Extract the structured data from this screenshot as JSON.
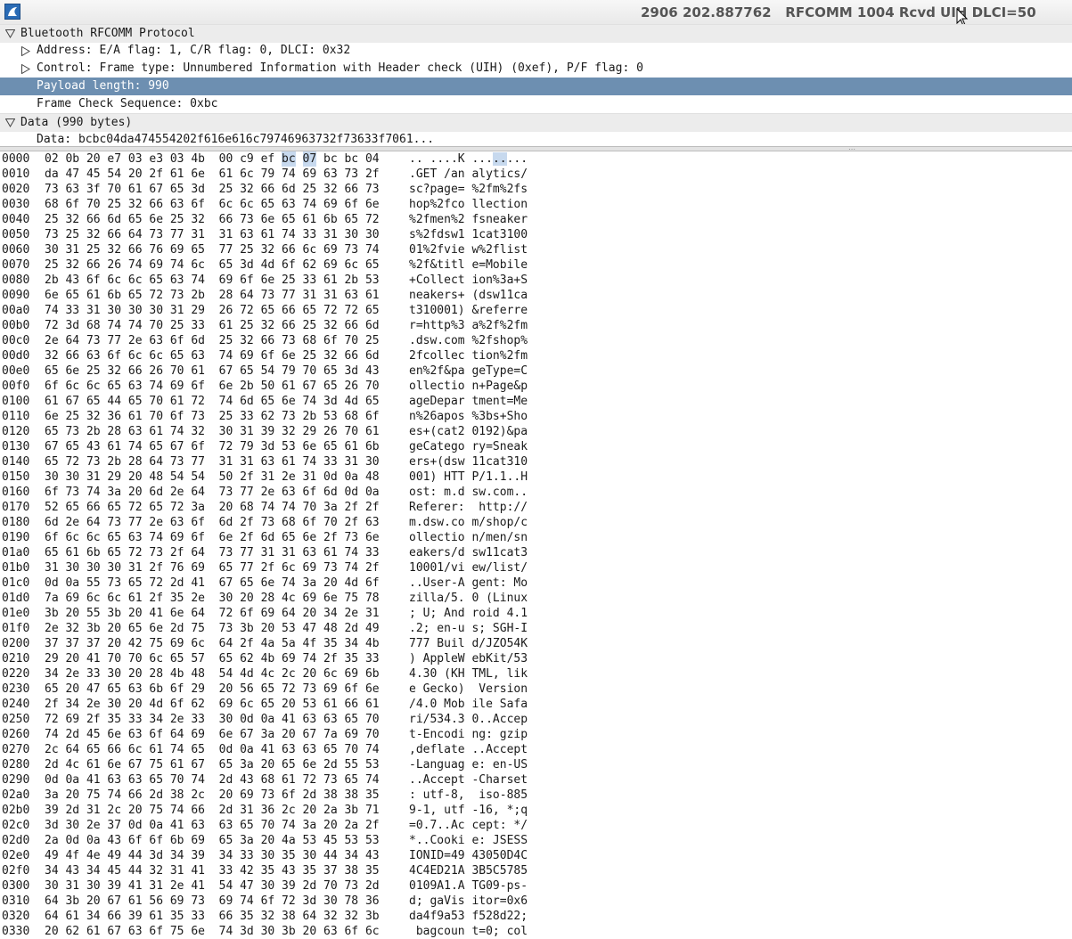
{
  "window": {
    "title": "2906 202.887762   RFCOMM 1004 Rcvd UIH DLCI=50",
    "icon": "wireshark-fin-icon"
  },
  "tree": [
    {
      "label": "Bluetooth RFCOMM Protocol",
      "level": 0,
      "expander": "expanded",
      "header": true
    },
    {
      "label": "Address: E/A flag: 1, C/R flag: 0, DLCI: 0x32",
      "level": 1,
      "expander": "collapsed"
    },
    {
      "label": "Control: Frame type: Unnumbered Information with Header check (UIH) (0xef), P/F flag: 0",
      "level": 1,
      "expander": "collapsed"
    },
    {
      "label": "Payload length: 990",
      "level": 1,
      "expander": "none",
      "selected": true
    },
    {
      "label": "Frame Check Sequence: 0xbc",
      "level": 1,
      "expander": "none"
    },
    {
      "label": "Data (990 bytes)",
      "level": 0,
      "expander": "expanded",
      "header": true
    },
    {
      "label": "Data: bcbc04da474554202f616e616c79746963732f73633f7061...",
      "level": 1,
      "expander": "none"
    }
  ],
  "hex_rows": [
    {
      "offset": "0000",
      "bytes": [
        "02",
        "0b",
        "20",
        "e7",
        "03",
        "e3",
        "03",
        "4b",
        "00",
        "c9",
        "ef",
        "bc",
        "07",
        "bc",
        "bc",
        "04"
      ],
      "ascii": ".. ....K ........"
    },
    {
      "offset": "0010",
      "bytes": [
        "da",
        "47",
        "45",
        "54",
        "20",
        "2f",
        "61",
        "6e",
        "61",
        "6c",
        "79",
        "74",
        "69",
        "63",
        "73",
        "2f"
      ],
      "ascii": ".GET /an alytics/"
    },
    {
      "offset": "0020",
      "bytes": [
        "73",
        "63",
        "3f",
        "70",
        "61",
        "67",
        "65",
        "3d",
        "25",
        "32",
        "66",
        "6d",
        "25",
        "32",
        "66",
        "73"
      ],
      "ascii": "sc?page= %2fm%2fs"
    },
    {
      "offset": "0030",
      "bytes": [
        "68",
        "6f",
        "70",
        "25",
        "32",
        "66",
        "63",
        "6f",
        "6c",
        "6c",
        "65",
        "63",
        "74",
        "69",
        "6f",
        "6e"
      ],
      "ascii": "hop%2fco llection"
    },
    {
      "offset": "0040",
      "bytes": [
        "25",
        "32",
        "66",
        "6d",
        "65",
        "6e",
        "25",
        "32",
        "66",
        "73",
        "6e",
        "65",
        "61",
        "6b",
        "65",
        "72"
      ],
      "ascii": "%2fmen%2 fsneaker"
    },
    {
      "offset": "0050",
      "bytes": [
        "73",
        "25",
        "32",
        "66",
        "64",
        "73",
        "77",
        "31",
        "31",
        "63",
        "61",
        "74",
        "33",
        "31",
        "30",
        "30"
      ],
      "ascii": "s%2fdsw1 1cat3100"
    },
    {
      "offset": "0060",
      "bytes": [
        "30",
        "31",
        "25",
        "32",
        "66",
        "76",
        "69",
        "65",
        "77",
        "25",
        "32",
        "66",
        "6c",
        "69",
        "73",
        "74"
      ],
      "ascii": "01%2fvie w%2flist"
    },
    {
      "offset": "0070",
      "bytes": [
        "25",
        "32",
        "66",
        "26",
        "74",
        "69",
        "74",
        "6c",
        "65",
        "3d",
        "4d",
        "6f",
        "62",
        "69",
        "6c",
        "65"
      ],
      "ascii": "%2f&titl e=Mobile"
    },
    {
      "offset": "0080",
      "bytes": [
        "2b",
        "43",
        "6f",
        "6c",
        "6c",
        "65",
        "63",
        "74",
        "69",
        "6f",
        "6e",
        "25",
        "33",
        "61",
        "2b",
        "53"
      ],
      "ascii": "+Collect ion%3a+S"
    },
    {
      "offset": "0090",
      "bytes": [
        "6e",
        "65",
        "61",
        "6b",
        "65",
        "72",
        "73",
        "2b",
        "28",
        "64",
        "73",
        "77",
        "31",
        "31",
        "63",
        "61"
      ],
      "ascii": "neakers+ (dsw11ca"
    },
    {
      "offset": "00a0",
      "bytes": [
        "74",
        "33",
        "31",
        "30",
        "30",
        "30",
        "31",
        "29",
        "26",
        "72",
        "65",
        "66",
        "65",
        "72",
        "72",
        "65"
      ],
      "ascii": "t310001) &referre"
    },
    {
      "offset": "00b0",
      "bytes": [
        "72",
        "3d",
        "68",
        "74",
        "74",
        "70",
        "25",
        "33",
        "61",
        "25",
        "32",
        "66",
        "25",
        "32",
        "66",
        "6d"
      ],
      "ascii": "r=http%3 a%2f%2fm"
    },
    {
      "offset": "00c0",
      "bytes": [
        "2e",
        "64",
        "73",
        "77",
        "2e",
        "63",
        "6f",
        "6d",
        "25",
        "32",
        "66",
        "73",
        "68",
        "6f",
        "70",
        "25"
      ],
      "ascii": ".dsw.com %2fshop%"
    },
    {
      "offset": "00d0",
      "bytes": [
        "32",
        "66",
        "63",
        "6f",
        "6c",
        "6c",
        "65",
        "63",
        "74",
        "69",
        "6f",
        "6e",
        "25",
        "32",
        "66",
        "6d"
      ],
      "ascii": "2fcollec tion%2fm"
    },
    {
      "offset": "00e0",
      "bytes": [
        "65",
        "6e",
        "25",
        "32",
        "66",
        "26",
        "70",
        "61",
        "67",
        "65",
        "54",
        "79",
        "70",
        "65",
        "3d",
        "43"
      ],
      "ascii": "en%2f&pa geType=C"
    },
    {
      "offset": "00f0",
      "bytes": [
        "6f",
        "6c",
        "6c",
        "65",
        "63",
        "74",
        "69",
        "6f",
        "6e",
        "2b",
        "50",
        "61",
        "67",
        "65",
        "26",
        "70"
      ],
      "ascii": "ollectio n+Page&p"
    },
    {
      "offset": "0100",
      "bytes": [
        "61",
        "67",
        "65",
        "44",
        "65",
        "70",
        "61",
        "72",
        "74",
        "6d",
        "65",
        "6e",
        "74",
        "3d",
        "4d",
        "65"
      ],
      "ascii": "ageDepar tment=Me"
    },
    {
      "offset": "0110",
      "bytes": [
        "6e",
        "25",
        "32",
        "36",
        "61",
        "70",
        "6f",
        "73",
        "25",
        "33",
        "62",
        "73",
        "2b",
        "53",
        "68",
        "6f"
      ],
      "ascii": "n%26apos %3bs+Sho"
    },
    {
      "offset": "0120",
      "bytes": [
        "65",
        "73",
        "2b",
        "28",
        "63",
        "61",
        "74",
        "32",
        "30",
        "31",
        "39",
        "32",
        "29",
        "26",
        "70",
        "61"
      ],
      "ascii": "es+(cat2 0192)&pa"
    },
    {
      "offset": "0130",
      "bytes": [
        "67",
        "65",
        "43",
        "61",
        "74",
        "65",
        "67",
        "6f",
        "72",
        "79",
        "3d",
        "53",
        "6e",
        "65",
        "61",
        "6b"
      ],
      "ascii": "geCatego ry=Sneak"
    },
    {
      "offset": "0140",
      "bytes": [
        "65",
        "72",
        "73",
        "2b",
        "28",
        "64",
        "73",
        "77",
        "31",
        "31",
        "63",
        "61",
        "74",
        "33",
        "31",
        "30"
      ],
      "ascii": "ers+(dsw 11cat310"
    },
    {
      "offset": "0150",
      "bytes": [
        "30",
        "30",
        "31",
        "29",
        "20",
        "48",
        "54",
        "54",
        "50",
        "2f",
        "31",
        "2e",
        "31",
        "0d",
        "0a",
        "48"
      ],
      "ascii": "001) HTT P/1.1..H"
    },
    {
      "offset": "0160",
      "bytes": [
        "6f",
        "73",
        "74",
        "3a",
        "20",
        "6d",
        "2e",
        "64",
        "73",
        "77",
        "2e",
        "63",
        "6f",
        "6d",
        "0d",
        "0a"
      ],
      "ascii": "ost: m.d sw.com.."
    },
    {
      "offset": "0170",
      "bytes": [
        "52",
        "65",
        "66",
        "65",
        "72",
        "65",
        "72",
        "3a",
        "20",
        "68",
        "74",
        "74",
        "70",
        "3a",
        "2f",
        "2f"
      ],
      "ascii": "Referer:  http://"
    },
    {
      "offset": "0180",
      "bytes": [
        "6d",
        "2e",
        "64",
        "73",
        "77",
        "2e",
        "63",
        "6f",
        "6d",
        "2f",
        "73",
        "68",
        "6f",
        "70",
        "2f",
        "63"
      ],
      "ascii": "m.dsw.co m/shop/c"
    },
    {
      "offset": "0190",
      "bytes": [
        "6f",
        "6c",
        "6c",
        "65",
        "63",
        "74",
        "69",
        "6f",
        "6e",
        "2f",
        "6d",
        "65",
        "6e",
        "2f",
        "73",
        "6e"
      ],
      "ascii": "ollectio n/men/sn"
    },
    {
      "offset": "01a0",
      "bytes": [
        "65",
        "61",
        "6b",
        "65",
        "72",
        "73",
        "2f",
        "64",
        "73",
        "77",
        "31",
        "31",
        "63",
        "61",
        "74",
        "33"
      ],
      "ascii": "eakers/d sw11cat3"
    },
    {
      "offset": "01b0",
      "bytes": [
        "31",
        "30",
        "30",
        "30",
        "31",
        "2f",
        "76",
        "69",
        "65",
        "77",
        "2f",
        "6c",
        "69",
        "73",
        "74",
        "2f"
      ],
      "ascii": "10001/vi ew/list/"
    },
    {
      "offset": "01c0",
      "bytes": [
        "0d",
        "0a",
        "55",
        "73",
        "65",
        "72",
        "2d",
        "41",
        "67",
        "65",
        "6e",
        "74",
        "3a",
        "20",
        "4d",
        "6f"
      ],
      "ascii": "..User-A gent: Mo"
    },
    {
      "offset": "01d0",
      "bytes": [
        "7a",
        "69",
        "6c",
        "6c",
        "61",
        "2f",
        "35",
        "2e",
        "30",
        "20",
        "28",
        "4c",
        "69",
        "6e",
        "75",
        "78"
      ],
      "ascii": "zilla/5. 0 (Linux"
    },
    {
      "offset": "01e0",
      "bytes": [
        "3b",
        "20",
        "55",
        "3b",
        "20",
        "41",
        "6e",
        "64",
        "72",
        "6f",
        "69",
        "64",
        "20",
        "34",
        "2e",
        "31"
      ],
      "ascii": "; U; And roid 4.1"
    },
    {
      "offset": "01f0",
      "bytes": [
        "2e",
        "32",
        "3b",
        "20",
        "65",
        "6e",
        "2d",
        "75",
        "73",
        "3b",
        "20",
        "53",
        "47",
        "48",
        "2d",
        "49"
      ],
      "ascii": ".2; en-u s; SGH-I"
    },
    {
      "offset": "0200",
      "bytes": [
        "37",
        "37",
        "37",
        "20",
        "42",
        "75",
        "69",
        "6c",
        "64",
        "2f",
        "4a",
        "5a",
        "4f",
        "35",
        "34",
        "4b"
      ],
      "ascii": "777 Buil d/JZO54K"
    },
    {
      "offset": "0210",
      "bytes": [
        "29",
        "20",
        "41",
        "70",
        "70",
        "6c",
        "65",
        "57",
        "65",
        "62",
        "4b",
        "69",
        "74",
        "2f",
        "35",
        "33"
      ],
      "ascii": ") AppleW ebKit/53"
    },
    {
      "offset": "0220",
      "bytes": [
        "34",
        "2e",
        "33",
        "30",
        "20",
        "28",
        "4b",
        "48",
        "54",
        "4d",
        "4c",
        "2c",
        "20",
        "6c",
        "69",
        "6b"
      ],
      "ascii": "4.30 (KH TML, lik"
    },
    {
      "offset": "0230",
      "bytes": [
        "65",
        "20",
        "47",
        "65",
        "63",
        "6b",
        "6f",
        "29",
        "20",
        "56",
        "65",
        "72",
        "73",
        "69",
        "6f",
        "6e"
      ],
      "ascii": "e Gecko)  Version"
    },
    {
      "offset": "0240",
      "bytes": [
        "2f",
        "34",
        "2e",
        "30",
        "20",
        "4d",
        "6f",
        "62",
        "69",
        "6c",
        "65",
        "20",
        "53",
        "61",
        "66",
        "61"
      ],
      "ascii": "/4.0 Mob ile Safa"
    },
    {
      "offset": "0250",
      "bytes": [
        "72",
        "69",
        "2f",
        "35",
        "33",
        "34",
        "2e",
        "33",
        "30",
        "0d",
        "0a",
        "41",
        "63",
        "63",
        "65",
        "70"
      ],
      "ascii": "ri/534.3 0..Accep"
    },
    {
      "offset": "0260",
      "bytes": [
        "74",
        "2d",
        "45",
        "6e",
        "63",
        "6f",
        "64",
        "69",
        "6e",
        "67",
        "3a",
        "20",
        "67",
        "7a",
        "69",
        "70"
      ],
      "ascii": "t-Encodi ng: gzip"
    },
    {
      "offset": "0270",
      "bytes": [
        "2c",
        "64",
        "65",
        "66",
        "6c",
        "61",
        "74",
        "65",
        "0d",
        "0a",
        "41",
        "63",
        "63",
        "65",
        "70",
        "74"
      ],
      "ascii": ",deflate ..Accept"
    },
    {
      "offset": "0280",
      "bytes": [
        "2d",
        "4c",
        "61",
        "6e",
        "67",
        "75",
        "61",
        "67",
        "65",
        "3a",
        "20",
        "65",
        "6e",
        "2d",
        "55",
        "53"
      ],
      "ascii": "-Languag e: en-US"
    },
    {
      "offset": "0290",
      "bytes": [
        "0d",
        "0a",
        "41",
        "63",
        "63",
        "65",
        "70",
        "74",
        "2d",
        "43",
        "68",
        "61",
        "72",
        "73",
        "65",
        "74"
      ],
      "ascii": "..Accept -Charset"
    },
    {
      "offset": "02a0",
      "bytes": [
        "3a",
        "20",
        "75",
        "74",
        "66",
        "2d",
        "38",
        "2c",
        "20",
        "69",
        "73",
        "6f",
        "2d",
        "38",
        "38",
        "35"
      ],
      "ascii": ": utf-8,  iso-885"
    },
    {
      "offset": "02b0",
      "bytes": [
        "39",
        "2d",
        "31",
        "2c",
        "20",
        "75",
        "74",
        "66",
        "2d",
        "31",
        "36",
        "2c",
        "20",
        "2a",
        "3b",
        "71"
      ],
      "ascii": "9-1, utf -16, *;q"
    },
    {
      "offset": "02c0",
      "bytes": [
        "3d",
        "30",
        "2e",
        "37",
        "0d",
        "0a",
        "41",
        "63",
        "63",
        "65",
        "70",
        "74",
        "3a",
        "20",
        "2a",
        "2f"
      ],
      "ascii": "=0.7..Ac cept: */"
    },
    {
      "offset": "02d0",
      "bytes": [
        "2a",
        "0d",
        "0a",
        "43",
        "6f",
        "6f",
        "6b",
        "69",
        "65",
        "3a",
        "20",
        "4a",
        "53",
        "45",
        "53",
        "53"
      ],
      "ascii": "*..Cooki e: JSESS"
    },
    {
      "offset": "02e0",
      "bytes": [
        "49",
        "4f",
        "4e",
        "49",
        "44",
        "3d",
        "34",
        "39",
        "34",
        "33",
        "30",
        "35",
        "30",
        "44",
        "34",
        "43"
      ],
      "ascii": "IONID=49 43050D4C"
    },
    {
      "offset": "02f0",
      "bytes": [
        "34",
        "43",
        "34",
        "45",
        "44",
        "32",
        "31",
        "41",
        "33",
        "42",
        "35",
        "43",
        "35",
        "37",
        "38",
        "35"
      ],
      "ascii": "4C4ED21A 3B5C5785"
    },
    {
      "offset": "0300",
      "bytes": [
        "30",
        "31",
        "30",
        "39",
        "41",
        "31",
        "2e",
        "41",
        "54",
        "47",
        "30",
        "39",
        "2d",
        "70",
        "73",
        "2d"
      ],
      "ascii": "0109A1.A TG09-ps-"
    },
    {
      "offset": "0310",
      "bytes": [
        "64",
        "3b",
        "20",
        "67",
        "61",
        "56",
        "69",
        "73",
        "69",
        "74",
        "6f",
        "72",
        "3d",
        "30",
        "78",
        "36"
      ],
      "ascii": "d; gaVis itor=0x6"
    },
    {
      "offset": "0320",
      "bytes": [
        "64",
        "61",
        "34",
        "66",
        "39",
        "61",
        "35",
        "33",
        "66",
        "35",
        "32",
        "38",
        "64",
        "32",
        "32",
        "3b"
      ],
      "ascii": "da4f9a53 f528d22;"
    },
    {
      "offset": "0330",
      "bytes": [
        "20",
        "62",
        "61",
        "67",
        "63",
        "6f",
        "75",
        "6e",
        "74",
        "3d",
        "30",
        "3b",
        "20",
        "63",
        "6f",
        "6c"
      ],
      "ascii": " bagcoun t=0; col"
    }
  ],
  "highlight": {
    "row": 0,
    "bytes": [
      11,
      12
    ],
    "ascii_chars": [
      11,
      12
    ]
  },
  "colors": {
    "selected_row": "#6d8fb1",
    "byte_highlight": "#c7d9ee",
    "header_row": "#ececec"
  }
}
